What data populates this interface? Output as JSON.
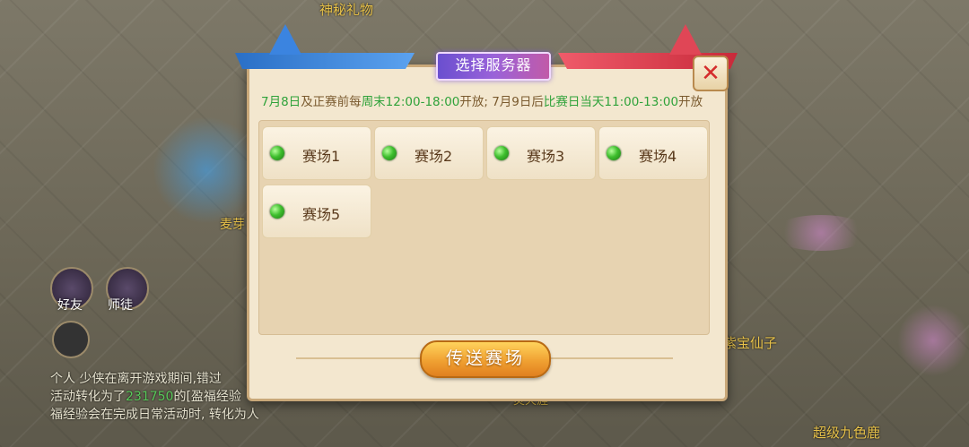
{
  "scene": {
    "top_label": "神秘礼物",
    "npc_labels": [
      "麦芽",
      "紫宝仙子",
      "超级九色鹿",
      "灵天涯"
    ],
    "side_buttons": [
      {
        "label": "好友",
        "icon": "wizard-hat-icon"
      },
      {
        "label": "师徒",
        "icon": "mentor-icon"
      }
    ],
    "chat": {
      "line1": "个人 少侠在离开游戏期间,错过",
      "line2_prefix": "活动转化为了",
      "line2_num": "231750",
      "line2_mid": "的[盈福经验",
      "line3": "福经验会在完成日常活动时, 转化为人"
    }
  },
  "dialog": {
    "title": "选择服务器",
    "notice": {
      "p1": "7月8日",
      "p2": "及正赛前每",
      "p3": "周末12:00-18:00",
      "p4": "开放; 7月9日后",
      "p5": "比赛日当天11:00-13:00",
      "p6": "开放"
    },
    "servers": [
      {
        "label": "赛场1",
        "status": "online"
      },
      {
        "label": "赛场2",
        "status": "online"
      },
      {
        "label": "赛场3",
        "status": "online"
      },
      {
        "label": "赛场4",
        "status": "online"
      },
      {
        "label": "赛场5",
        "status": "online"
      }
    ],
    "action_button": "传送赛场"
  },
  "colors": {
    "online": "#3fbf2e",
    "highlight_green": "#2fa23a",
    "header_blue": "#3b84e0",
    "header_red": "#e04656",
    "button_orange": "#f0a132"
  }
}
